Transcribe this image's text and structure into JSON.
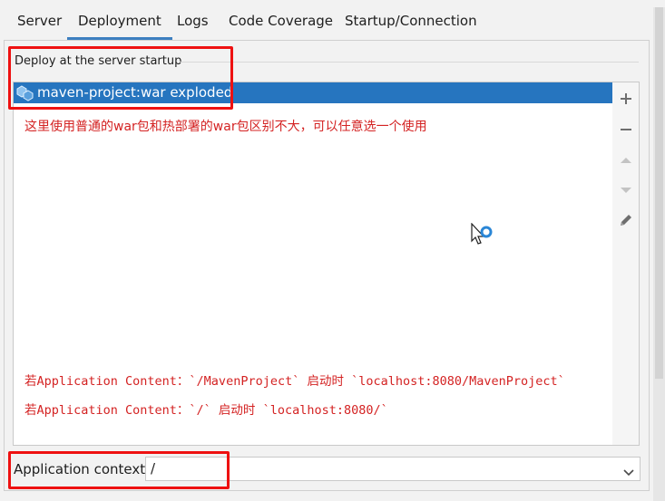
{
  "tabs": [
    {
      "label": "Server"
    },
    {
      "label": "Deployment",
      "active": true
    },
    {
      "label": "Logs"
    },
    {
      "label": "Code Coverage"
    },
    {
      "label": "Startup/Connection"
    }
  ],
  "deploy": {
    "group_title": "Deploy at the server startup",
    "items": [
      {
        "label": "maven-project:war exploded",
        "icon": "artifact-icon",
        "selected": true
      }
    ]
  },
  "notes": {
    "line1": "这里使用普通的war包和热部署的war包区别不大，可以任意选一个使用",
    "line2": "若Application Content：`/MavenProject` 启动时 `localhost:8080/MavenProject`",
    "line3": "若Application Content：`/` 启动时 `localhost:8080/`"
  },
  "toolbar": {
    "icons": [
      "add-icon",
      "remove-icon",
      "move-up-icon",
      "move-down-icon",
      "edit-icon"
    ]
  },
  "context": {
    "label": "Application context:",
    "value": "/"
  },
  "colors": {
    "selection": "#2675bf",
    "tab_underline": "#3d7fc0",
    "note_text": "#d42323",
    "highlight_box": "#ee1111"
  }
}
